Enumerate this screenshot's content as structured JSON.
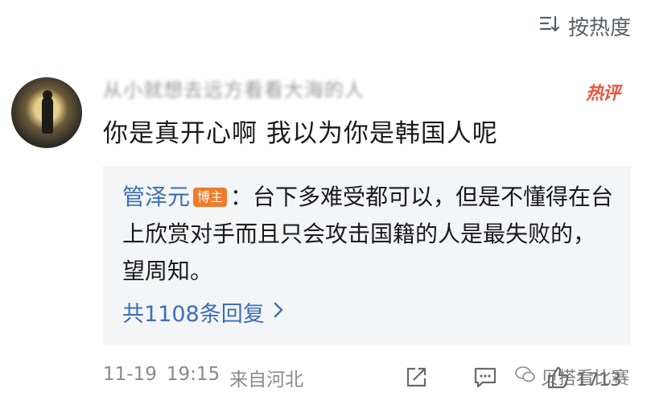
{
  "sort": {
    "label": "按热度"
  },
  "comment": {
    "username": "从小就想去远方看看大海的人",
    "hot_badge": "热评",
    "text": "你是真开心啊  我以为你是韩国人呢"
  },
  "reply": {
    "author": "管泽元",
    "author_badge": "博主",
    "separator": "：",
    "text": "台下多难受都可以，但是不懂得在台上欣赏对手而且只会攻击国籍的人是最失败的，望周知。",
    "more": "共1108条回复"
  },
  "footer": {
    "date": "11-19",
    "time": "19:15",
    "location": "来自河北",
    "likes": "1713"
  },
  "watermark": "贝搭看比赛",
  "colors": {
    "accent": "#3b6fb5",
    "hot": "#e8553f",
    "badge": "#f07a2c"
  }
}
